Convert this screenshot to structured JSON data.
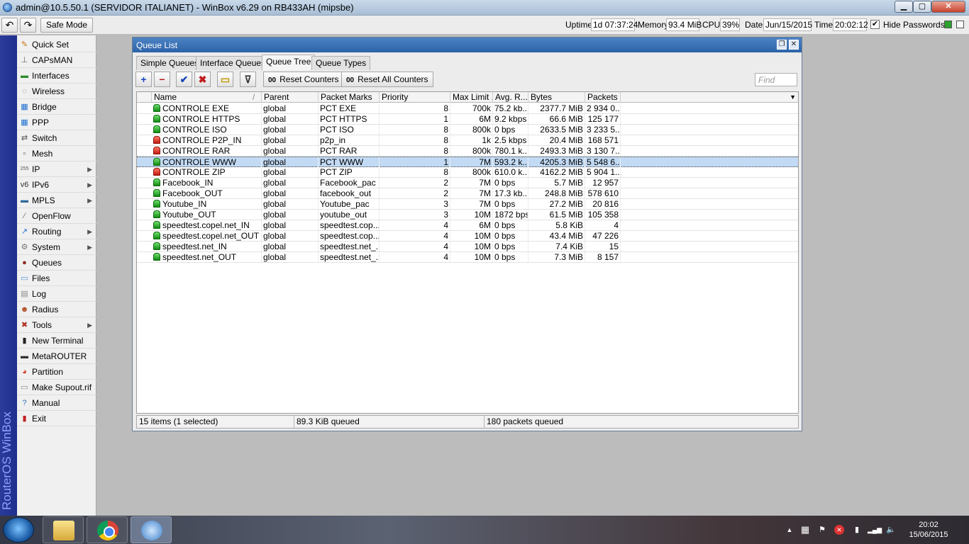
{
  "titlebar": {
    "title": "admin@10.5.50.1 (SERVIDOR ITALIANET) - WinBox v6.29 on RB433AH (mipsbe)",
    "min": "▁",
    "max": "▢",
    "close": "✕"
  },
  "toolbar": {
    "undo": "↶",
    "redo": "↷",
    "safe_mode": "Safe Mode",
    "uptime_label": "Uptime:",
    "uptime": "1d 07:37:24",
    "memory_label": "Memory:",
    "memory": "93.4 MiB",
    "cpu_label": "CPU:",
    "cpu": "39%",
    "date_label": "Date:",
    "date": "Jun/15/2015",
    "time_label": "Time:",
    "time": "20:02:12",
    "hide_passwords_checked": "✔",
    "hide_passwords": "Hide Passwords"
  },
  "sideband": {
    "text": "RouterOS WinBox"
  },
  "menu": [
    {
      "label": "Quick Set",
      "icon": "quickset-icon",
      "glyph": "✎",
      "color": "#c8730d",
      "arrow": ""
    },
    {
      "label": "CAPsMAN",
      "icon": "capsman-icon",
      "glyph": "⊥",
      "color": "#666666",
      "arrow": ""
    },
    {
      "label": "Interfaces",
      "icon": "interfaces-icon",
      "glyph": "▬",
      "color": "#2e8b2e",
      "arrow": ""
    },
    {
      "label": "Wireless",
      "icon": "wireless-icon",
      "glyph": "◌",
      "color": "#777777",
      "arrow": ""
    },
    {
      "label": "Bridge",
      "icon": "bridge-icon",
      "glyph": "▦",
      "color": "#1f6fd0",
      "arrow": ""
    },
    {
      "label": "PPP",
      "icon": "ppp-icon",
      "glyph": "▦",
      "color": "#1f6fd0",
      "arrow": ""
    },
    {
      "label": "Switch",
      "icon": "switch-icon",
      "glyph": "⇄",
      "color": "#555555",
      "arrow": ""
    },
    {
      "label": "Mesh",
      "icon": "mesh-icon",
      "glyph": "∘",
      "color": "#777777",
      "arrow": ""
    },
    {
      "label": "IP",
      "icon": "ip-icon",
      "glyph": "255",
      "color": "#555555",
      "arrow": "▶"
    },
    {
      "label": "IPv6",
      "icon": "ipv6-icon",
      "glyph": "v6",
      "color": "#333333",
      "arrow": "▶"
    },
    {
      "label": "MPLS",
      "icon": "mpls-icon",
      "glyph": "▬",
      "color": "#2f6b9c",
      "arrow": "▶"
    },
    {
      "label": "OpenFlow",
      "icon": "openflow-icon",
      "glyph": "⁄",
      "color": "#666666",
      "arrow": ""
    },
    {
      "label": "Routing",
      "icon": "routing-icon",
      "glyph": "↗",
      "color": "#1f6fd0",
      "arrow": "▶"
    },
    {
      "label": "System",
      "icon": "system-icon",
      "glyph": "⚙",
      "color": "#777777",
      "arrow": "▶"
    },
    {
      "label": "Queues",
      "icon": "queues-icon",
      "glyph": "●",
      "color": "#8b2e1f",
      "arrow": ""
    },
    {
      "label": "Files",
      "icon": "files-icon",
      "glyph": "▭",
      "color": "#4a8fd8",
      "arrow": ""
    },
    {
      "label": "Log",
      "icon": "log-icon",
      "glyph": "▤",
      "color": "#888888",
      "arrow": ""
    },
    {
      "label": "Radius",
      "icon": "radius-icon",
      "glyph": "☻",
      "color": "#b04a22",
      "arrow": ""
    },
    {
      "label": "Tools",
      "icon": "tools-icon",
      "glyph": "✖",
      "color": "#b03020",
      "arrow": "▶"
    },
    {
      "label": "New Terminal",
      "icon": "terminal-icon",
      "glyph": "▮",
      "color": "#222222",
      "arrow": ""
    },
    {
      "label": "MetaROUTER",
      "icon": "metarouter-icon",
      "glyph": "▬",
      "color": "#333333",
      "arrow": ""
    },
    {
      "label": "Partition",
      "icon": "partition-icon",
      "glyph": "◕",
      "color": "#d23a2a",
      "arrow": ""
    },
    {
      "label": "Make Supout.rif",
      "icon": "supout-icon",
      "glyph": "▭",
      "color": "#888888",
      "arrow": ""
    },
    {
      "label": "Manual",
      "icon": "manual-icon",
      "glyph": "?",
      "color": "#2d6fb8",
      "arrow": ""
    },
    {
      "label": "Exit",
      "icon": "exit-icon",
      "glyph": "▮",
      "color": "#c02020",
      "arrow": ""
    }
  ],
  "queue_window": {
    "title": "Queue List",
    "btn_restore": "❐",
    "btn_close": "✕",
    "tabs": [
      "Simple Queues",
      "Interface Queues",
      "Queue Tree",
      "Queue Types"
    ],
    "active_tab": 2,
    "tools": {
      "add": "+",
      "remove": "−",
      "enable": "✔",
      "disable": "✖",
      "comment": "▭",
      "filter": "⊽"
    },
    "reset_counters": "Reset Counters",
    "reset_all_counters": "Reset All Counters",
    "counter_glyph": "00",
    "find_placeholder": "Find",
    "columns": [
      "Name",
      "Parent",
      "Packet Marks",
      "Priority",
      "Max Limit ...",
      "Avg. R...",
      "Bytes",
      "Packets"
    ],
    "sort_glyph": "/",
    "dropdown_glyph": "▼",
    "rows": [
      {
        "name": "CONTROLE EXE",
        "status": "green",
        "parent": "global",
        "marks": "PCT EXE",
        "priority": "8",
        "max": "700k",
        "avg": "75.2 kb...",
        "bytes": "2377.7 MiB",
        "packets": "2 934 0...",
        "selected": false
      },
      {
        "name": "CONTROLE HTTPS",
        "status": "green",
        "parent": "global",
        "marks": "PCT HTTPS",
        "priority": "1",
        "max": "6M",
        "avg": "9.2 kbps",
        "bytes": "66.6 MiB",
        "packets": "125 177",
        "selected": false
      },
      {
        "name": "CONTROLE ISO",
        "status": "green",
        "parent": "global",
        "marks": "PCT ISO",
        "priority": "8",
        "max": "800k",
        "avg": "0 bps",
        "bytes": "2633.5 MiB",
        "packets": "3 233 5...",
        "selected": false
      },
      {
        "name": "CONTROLE P2P_IN",
        "status": "red",
        "parent": "global",
        "marks": "p2p_in",
        "priority": "8",
        "max": "1k",
        "avg": "2.5 kbps",
        "bytes": "20.4 MiB",
        "packets": "168 571",
        "selected": false
      },
      {
        "name": "CONTROLE RAR",
        "status": "red",
        "parent": "global",
        "marks": "PCT RAR",
        "priority": "8",
        "max": "800k",
        "avg": "780.1 k...",
        "bytes": "2493.3 MiB",
        "packets": "3 130 7...",
        "selected": false
      },
      {
        "name": "CONTROLE WWW",
        "status": "green",
        "parent": "global",
        "marks": "PCT WWW",
        "priority": "1",
        "max": "7M",
        "avg": "593.2 k...",
        "bytes": "4205.3 MiB",
        "packets": "5 548 6...",
        "selected": true
      },
      {
        "name": "CONTROLE ZIP",
        "status": "red",
        "parent": "global",
        "marks": "PCT ZIP",
        "priority": "8",
        "max": "800k",
        "avg": "610.0 k...",
        "bytes": "4162.2 MiB",
        "packets": "5 904 1...",
        "selected": false
      },
      {
        "name": "Facebook_IN",
        "status": "green",
        "parent": "global",
        "marks": "Facebook_pac",
        "priority": "2",
        "max": "7M",
        "avg": "0 bps",
        "bytes": "5.7 MiB",
        "packets": "12 957",
        "selected": false
      },
      {
        "name": "Facebook_OUT",
        "status": "green",
        "parent": "global",
        "marks": "facebook_out",
        "priority": "2",
        "max": "7M",
        "avg": "17.3 kb...",
        "bytes": "248.8 MiB",
        "packets": "578 610",
        "selected": false
      },
      {
        "name": "Youtube_IN",
        "status": "green",
        "parent": "global",
        "marks": "Youtube_pac",
        "priority": "3",
        "max": "7M",
        "avg": "0 bps",
        "bytes": "27.2 MiB",
        "packets": "20 816",
        "selected": false
      },
      {
        "name": "Youtube_OUT",
        "status": "green",
        "parent": "global",
        "marks": "youtube_out",
        "priority": "3",
        "max": "10M",
        "avg": "1872 bps",
        "bytes": "61.5 MiB",
        "packets": "105 358",
        "selected": false
      },
      {
        "name": "speedtest.copel.net_IN",
        "status": "green",
        "parent": "global",
        "marks": "speedtest.cop...",
        "priority": "4",
        "max": "6M",
        "avg": "0 bps",
        "bytes": "5.8 KiB",
        "packets": "4",
        "selected": false
      },
      {
        "name": "speedtest.copel.net_OUT",
        "status": "green",
        "parent": "global",
        "marks": "speedtest.cop...",
        "priority": "4",
        "max": "10M",
        "avg": "0 bps",
        "bytes": "43.4 MiB",
        "packets": "47 226",
        "selected": false
      },
      {
        "name": "speedtest.net_IN",
        "status": "green",
        "parent": "global",
        "marks": "speedtest.net_...",
        "priority": "4",
        "max": "10M",
        "avg": "0 bps",
        "bytes": "7.4 KiB",
        "packets": "15",
        "selected": false
      },
      {
        "name": "speedtest.net_OUT",
        "status": "green",
        "parent": "global",
        "marks": "speedtest.net_...",
        "priority": "4",
        "max": "10M",
        "avg": "0 bps",
        "bytes": "7.3 MiB",
        "packets": "8 157",
        "selected": false
      }
    ],
    "status": {
      "items": "15 items (1 selected)",
      "queued": "89.3 KiB queued",
      "packets_queued": "180 packets queued"
    }
  },
  "taskbar": {
    "clock_time": "20:02",
    "clock_date": "15/06/2015",
    "tray_show_hidden": "▲",
    "tray_action_center": "⚑",
    "tray_network": "▂▄▆",
    "tray_volume": "🔈"
  }
}
